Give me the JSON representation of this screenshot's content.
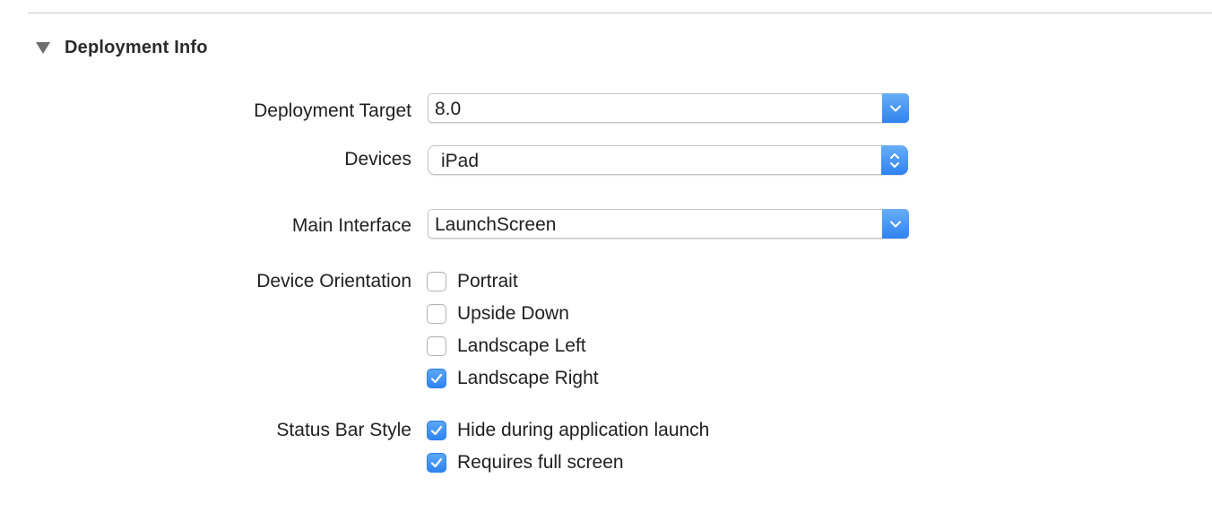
{
  "section": {
    "title": "Deployment Info"
  },
  "deployment_target": {
    "label": "Deployment Target",
    "value": "8.0"
  },
  "devices": {
    "label": "Devices",
    "value": "iPad"
  },
  "main_interface": {
    "label": "Main Interface",
    "value": "LaunchScreen"
  },
  "device_orientation": {
    "label": "Device Orientation",
    "options": [
      {
        "label": "Portrait",
        "checked": false
      },
      {
        "label": "Upside Down",
        "checked": false
      },
      {
        "label": "Landscape Left",
        "checked": false
      },
      {
        "label": "Landscape Right",
        "checked": true
      }
    ]
  },
  "status_bar_style": {
    "label": "Status Bar Style",
    "options": [
      {
        "label": "Hide during application launch",
        "checked": true
      },
      {
        "label": "Requires full screen",
        "checked": true
      }
    ]
  },
  "colors": {
    "accent": "#2f83f0",
    "divider": "#c9c9c9"
  }
}
